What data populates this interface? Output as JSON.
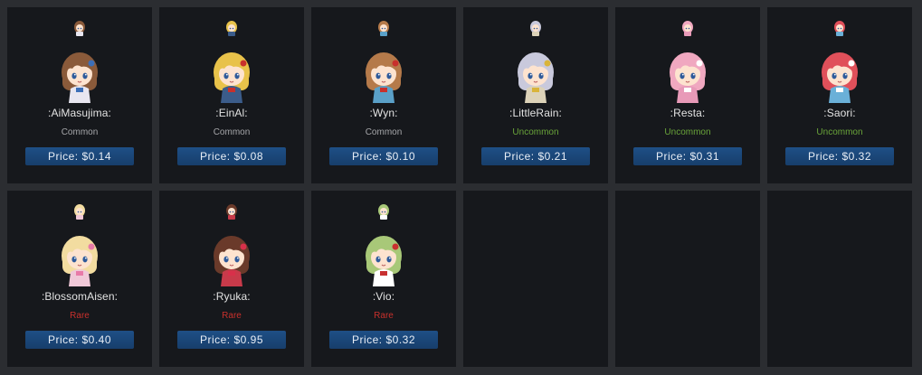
{
  "items": [
    {
      "name": ":AiMasujima:",
      "rarity": "Common",
      "price": "Price: $0.14",
      "hair": "#8a5a3a",
      "outfit": "#e8e6f0",
      "accent": "#3c6fb8"
    },
    {
      "name": ":EinAl:",
      "rarity": "Common",
      "price": "Price: $0.08",
      "hair": "#e8c24a",
      "outfit": "#3b5c8a",
      "accent": "#c8302c"
    },
    {
      "name": ":Wyn:",
      "rarity": "Common",
      "price": "Price: $0.10",
      "hair": "#b57a4a",
      "outfit": "#5aa0c8",
      "accent": "#c8302c"
    },
    {
      "name": ":LittleRain:",
      "rarity": "Uncommon",
      "price": "Price: $0.21",
      "hair": "#c9c9dc",
      "outfit": "#dcd2b8",
      "accent": "#d9b43a"
    },
    {
      "name": ":Resta:",
      "rarity": "Uncommon",
      "price": "Price: $0.31",
      "hair": "#f0a8c0",
      "outfit": "#e89ab8",
      "accent": "#ffffff"
    },
    {
      "name": ":Saori:",
      "rarity": "Uncommon",
      "price": "Price: $0.32",
      "hair": "#e0505a",
      "outfit": "#6ab0d8",
      "accent": "#ffffff"
    },
    {
      "name": ":BlossomAisen:",
      "rarity": "Rare",
      "price": "Price: $0.40",
      "hair": "#f2dca0",
      "outfit": "#f0c8d8",
      "accent": "#e87aa8"
    },
    {
      "name": ":Ryuka:",
      "rarity": "Rare",
      "price": "Price: $0.95",
      "hair": "#6a3a2a",
      "outfit": "#c83a4a",
      "accent": "#d8304a"
    },
    {
      "name": ":Vio:",
      "rarity": "Rare",
      "price": "Price: $0.32",
      "hair": "#a8c878",
      "outfit": "#ffffff",
      "accent": "#c83030"
    }
  ],
  "empty_slots": 3,
  "rarity_colors": {
    "Common": "#a6a7aa",
    "Uncommon": "#6aa53a",
    "Rare": "#c8302c"
  },
  "icons": {
    "thumb": "character-thumbnail-icon",
    "avatar": "character-avatar-icon"
  }
}
